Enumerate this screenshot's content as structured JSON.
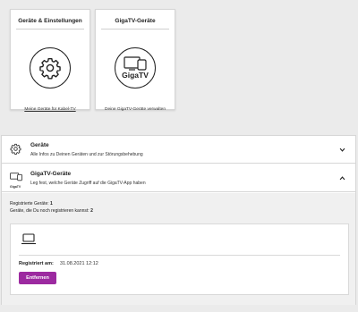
{
  "tiles": [
    {
      "title": "Geräte & Einstellungen",
      "icon": "gear-icon",
      "link": "Meine Geräte für Kabel-TV"
    },
    {
      "title": "GigaTV-Geräte",
      "icon": "gigatv-devices-icon",
      "icon_text": "GigaTV",
      "link": "Deine GigaTV-Geräte verwalten"
    }
  ],
  "accordion": [
    {
      "title": "Geräte",
      "subtitle": "Alle Infos zu Deinen Geräten und zur Störungsbehebung",
      "icon": "gear-icon",
      "state": "collapsed"
    },
    {
      "title": "GigaTV-Geräte",
      "subtitle": "Leg fest, welche Geräte Zugriff auf die GigaTV-App haben",
      "icon": "gigatv-icon",
      "icon_text": "GigaTV",
      "state": "expanded"
    }
  ],
  "registration": {
    "registered_label": "Registrierte Geräte:",
    "registered_count": "1",
    "remaining_label": "Geräte, die Du noch registrieren kannst:",
    "remaining_count": "2"
  },
  "device": {
    "icon": "laptop-icon",
    "registered_at_label": "Registriert am:",
    "registered_at_value": "31.08.2021 12:12",
    "remove_label": "Entfernen"
  },
  "colors": {
    "accent": "#9c2aa0",
    "page_background": "#ebebeb"
  }
}
